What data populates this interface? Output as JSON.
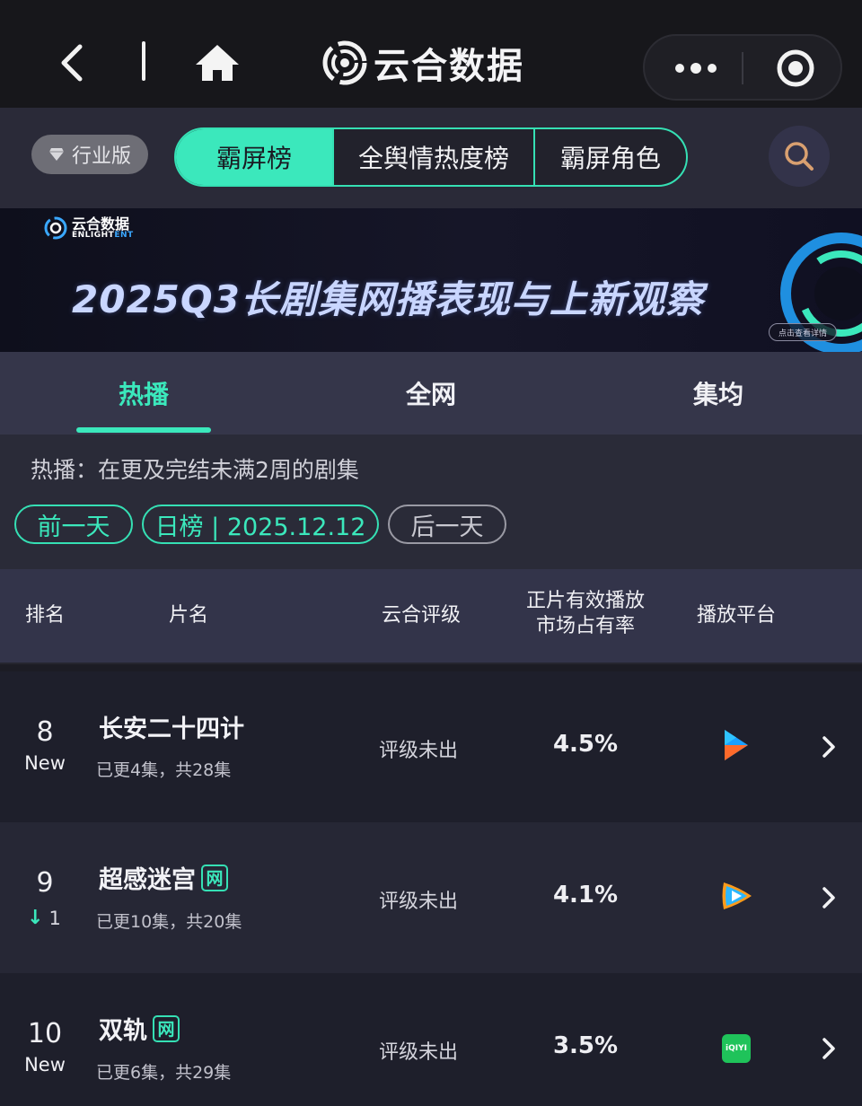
{
  "topbar": {
    "brand_name": "云合数据"
  },
  "filter": {
    "industry_label": "行业版",
    "segments": [
      "霸屏榜",
      "全舆情热度榜",
      "霸屏角色"
    ],
    "active_segment": 0
  },
  "banner": {
    "logo_cn": "云合数据",
    "logo_en_a": "ENLIGHT",
    "logo_en_b": "ENT",
    "title": "2025Q3长剧集网播表现与上新观察",
    "detail_button": "点击查看详情"
  },
  "tabs": {
    "items": [
      "热播",
      "全网",
      "集均"
    ],
    "active": 0
  },
  "info": {
    "description": "热播：在更及完结未满2周的剧集",
    "prev_day": "前一天",
    "current": "日榜 | 2025.12.12",
    "next_day": "后一天"
  },
  "table": {
    "headers": {
      "rank": "排名",
      "title": "片名",
      "rating": "云合评级",
      "share_line1": "正片有效播放",
      "share_line2": "市场占有率",
      "platform": "播放平台"
    },
    "rows": [
      {
        "rank": "8",
        "rank_tag": "New",
        "title": "长安二十四计",
        "net_badge": "",
        "episodes": "已更4集，共28集",
        "rating": "评级未出",
        "share": "4.5%",
        "platform": "youku-icon"
      },
      {
        "rank": "9",
        "rank_move_arrow": "↓",
        "rank_move": "1",
        "title": "超感迷宫",
        "net_badge": "网",
        "episodes": "已更10集，共20集",
        "rating": "评级未出",
        "share": "4.1%",
        "platform": "tencent-video-icon"
      },
      {
        "rank": "10",
        "rank_tag": "New",
        "title": "双轨",
        "net_badge": "网",
        "episodes": "已更6集，共29集",
        "rating": "评级未出",
        "share": "3.5%",
        "platform": "iqiyi-icon",
        "platform_text": "iQIYI"
      }
    ]
  },
  "colors": {
    "accent": "#3be8bc",
    "bg": "#1c1c24",
    "header_bg": "#33344a"
  }
}
